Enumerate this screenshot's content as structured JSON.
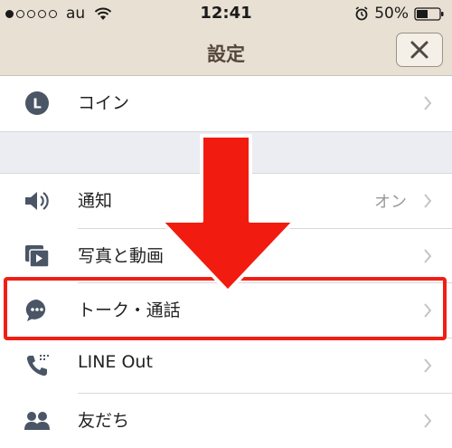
{
  "status_bar": {
    "carrier": "au",
    "time": "12:41",
    "battery_percent": "50%",
    "signal_dots_filled": 1,
    "signal_dots_total": 5,
    "battery_level": 0.5
  },
  "nav": {
    "title": "設定",
    "close_icon": "close-icon"
  },
  "rows": [
    {
      "label": "コイン",
      "icon": "coin-icon",
      "value": ""
    },
    {
      "label": "通知",
      "icon": "speaker-icon",
      "value": "オン"
    },
    {
      "label": "写真と動画",
      "icon": "photo-video-icon",
      "value": ""
    },
    {
      "label": "トーク・通話",
      "icon": "chat-bubble-icon",
      "value": ""
    },
    {
      "label": "LINE Out",
      "icon": "phone-icon",
      "value": ""
    },
    {
      "label": "友だち",
      "icon": "friends-icon",
      "value": ""
    }
  ],
  "coin_icon_letter": "L",
  "colors": {
    "header_bg": "#e8e0d3",
    "icon_color": "#4a5566",
    "highlight": "#f01e14",
    "chevron": "#c4c4c4"
  }
}
